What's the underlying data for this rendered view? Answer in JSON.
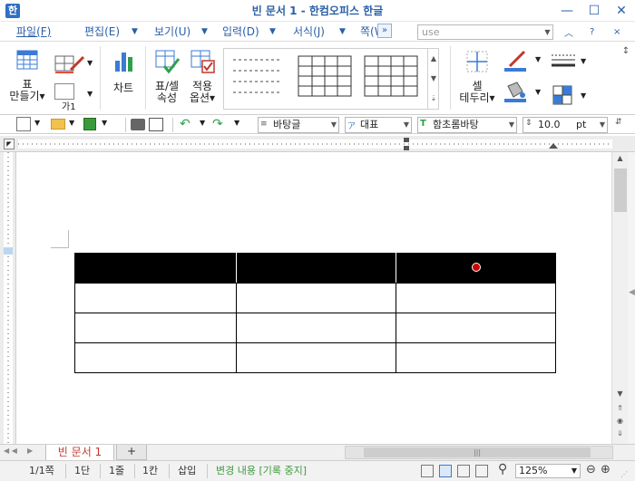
{
  "window": {
    "title": "빈 문서 1 - 한컴오피스 한글",
    "app_icon": "hwp-app-icon"
  },
  "menu": {
    "items": [
      "파일(F)",
      "편집(E)",
      "보기(U)",
      "입력(D)",
      "서식(J)",
      "쪽(W)"
    ],
    "more": "»",
    "command_input_value": "use"
  },
  "ribbon": {
    "table_label": "표",
    "table_create_label": "만들기",
    "char_style_label": "가1",
    "chart_label": "차트",
    "table_cell_props_label_1": "표/셀",
    "table_cell_props_label_2": "속성",
    "apply_options_label_1": "적용",
    "apply_options_label_2": "옵션",
    "cell_border_label_1": "셀",
    "cell_border_label_2": "테두리"
  },
  "toolbar": {
    "style_combo": "바탕글",
    "lang_combo": "대표",
    "font_combo": "함초롬바탕",
    "size_value": "10.0",
    "size_unit": "pt"
  },
  "tabs": {
    "doc_tab_label": "빈 문서 1",
    "add_tab": "+"
  },
  "status": {
    "page": "1/1쪽",
    "section": "1단",
    "line": "1줄",
    "column": "1칸",
    "mode": "삽입",
    "track_changes": "변경 내용 [기록 중지]",
    "zoom": "125%"
  },
  "colors": {
    "accent": "#2a5fa8",
    "tab_text": "#c0392b",
    "track_changes": "#3f9b3f",
    "header_row": "#000000",
    "red_dot": "#cc0000"
  }
}
